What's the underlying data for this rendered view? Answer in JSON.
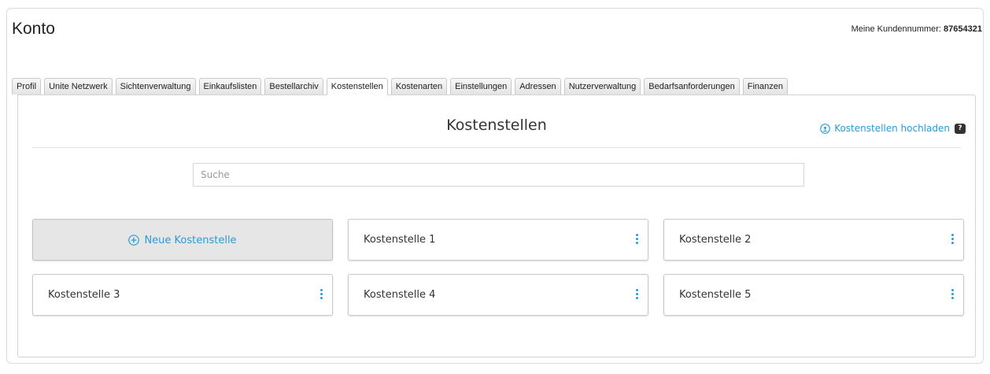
{
  "header": {
    "title": "Konto",
    "customer_label": "Meine Kundennummer:",
    "customer_number": "87654321"
  },
  "tabs": [
    {
      "label": "Profil",
      "active": false
    },
    {
      "label": "Unite Netzwerk",
      "active": false
    },
    {
      "label": "Sichtenverwaltung",
      "active": false
    },
    {
      "label": "Einkaufslisten",
      "active": false
    },
    {
      "label": "Bestellarchiv",
      "active": false
    },
    {
      "label": "Kostenstellen",
      "active": true
    },
    {
      "label": "Kostenarten",
      "active": false
    },
    {
      "label": "Einstellungen",
      "active": false
    },
    {
      "label": "Adressen",
      "active": false
    },
    {
      "label": "Nutzerverwaltung",
      "active": false
    },
    {
      "label": "Bedarfsanforderungen",
      "active": false
    },
    {
      "label": "Finanzen",
      "active": false
    }
  ],
  "panel": {
    "title": "Kostenstellen",
    "upload_label": "Kostenstellen hochladen",
    "help_badge": "?",
    "search_placeholder": "Suche",
    "new_label": "Neue Kostenstelle",
    "items": [
      {
        "label": "Kostenstelle 1"
      },
      {
        "label": "Kostenstelle 2"
      },
      {
        "label": "Kostenstelle 3"
      },
      {
        "label": "Kostenstelle 4"
      },
      {
        "label": "Kostenstelle 5"
      }
    ]
  },
  "colors": {
    "accent": "#2a9bd6",
    "text": "#333333",
    "border": "#c8c8c8",
    "new_card_bg": "#e6e6e6"
  },
  "icons": {
    "upload": "upload-circle-icon",
    "add": "plus-circle-icon",
    "menu": "vertical-dots-icon",
    "help": "help-icon"
  }
}
